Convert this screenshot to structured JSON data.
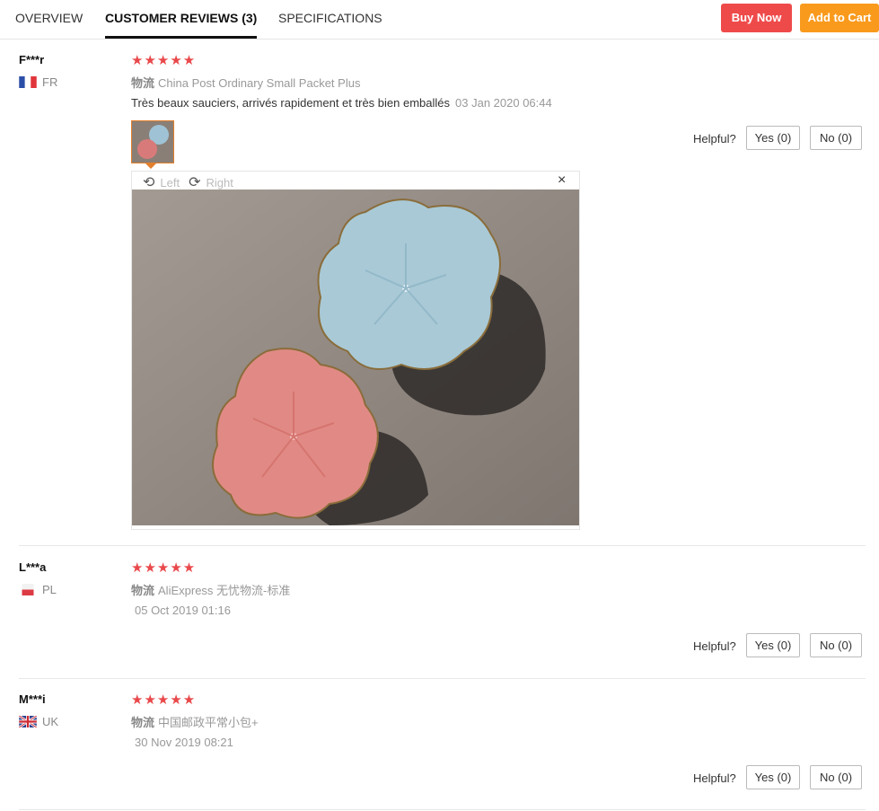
{
  "tabs": [
    {
      "label": "OVERVIEW"
    },
    {
      "label": "CUSTOMER REVIEWS (3)"
    },
    {
      "label": "SPECIFICATIONS"
    }
  ],
  "actions": {
    "buy_now": "Buy Now",
    "add_to_cart": "Add to Cart"
  },
  "reviews": [
    {
      "user": "F***r",
      "country": "FR",
      "stars": "★★★★★",
      "ship_label": "物流",
      "shipping": "China Post Ordinary Small Packet Plus",
      "text": "Très beaux sauciers, arrivés rapidement et très bien emballés",
      "date": "03 Jan 2020 06:44",
      "helpful": "Helpful?",
      "yes": "Yes (0)",
      "no": "No (0)"
    },
    {
      "user": "L***a",
      "country": "PL",
      "stars": "★★★★★",
      "ship_label": "物流",
      "shipping": "AliExpress 无忧物流-标准",
      "date": "05 Oct 2019 01:16",
      "helpful": "Helpful?",
      "yes": "Yes (0)",
      "no": "No (0)"
    },
    {
      "user": "M***i",
      "country": "UK",
      "stars": "★★★★★",
      "ship_label": "物流",
      "shipping": "中国邮政平常小包+",
      "date": "30 Nov 2019 08:21",
      "helpful": "Helpful?",
      "yes": "Yes (0)",
      "no": "No (0)"
    }
  ],
  "viewer": {
    "rotate_left": "Left",
    "rotate_right": "Right",
    "close": "×"
  },
  "colors": {
    "accent_red": "#ef4a4a",
    "accent_orange": "#f99a1c",
    "star": "#e9484b",
    "thumb_border": "#e37f2c"
  }
}
